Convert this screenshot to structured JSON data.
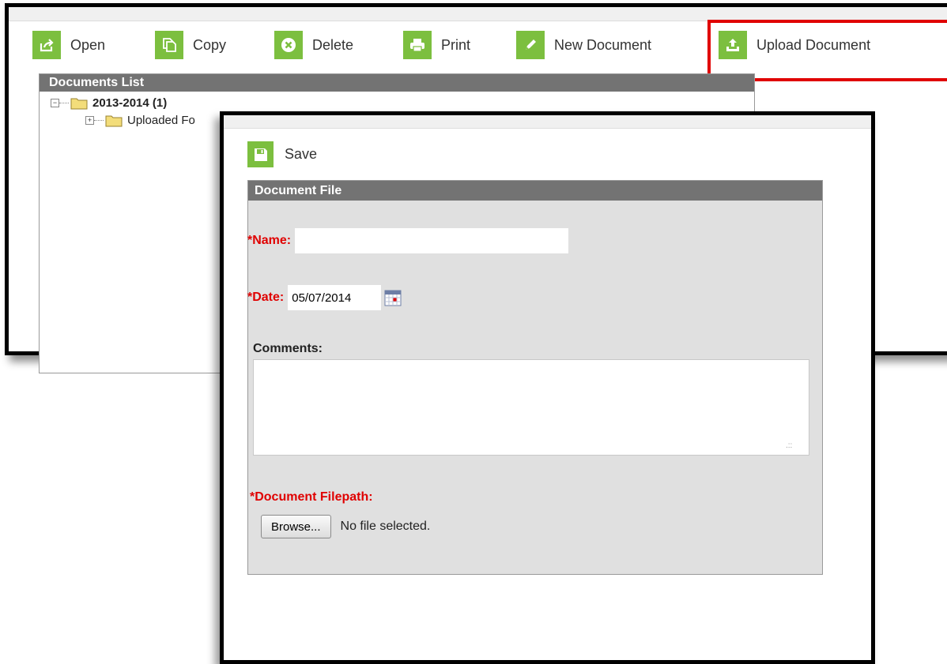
{
  "toolbar": {
    "open_label": "Open",
    "copy_label": "Copy",
    "delete_label": "Delete",
    "print_label": "Print",
    "new_document_label": "New Document",
    "upload_document_label": "Upload Document"
  },
  "documents_list": {
    "title": "Documents List",
    "tree": [
      {
        "label": "2013-2014 (1)"
      },
      {
        "label": "Uploaded Fo"
      }
    ]
  },
  "dialog": {
    "save_label": "Save",
    "panel_title": "Document File",
    "name": {
      "label": "*Name:",
      "value": ""
    },
    "date": {
      "label": "*Date:",
      "value": "05/07/2014"
    },
    "comments": {
      "label": "Comments:",
      "value": ""
    },
    "filepath": {
      "label": "*Document Filepath:",
      "browse_label": "Browse...",
      "status": "No file selected."
    }
  },
  "colors": {
    "accent_green": "#7cbf3f",
    "header_gray": "#737373",
    "required_red": "#e00000",
    "highlight_red": "#e00000"
  },
  "icons": [
    "open-icon",
    "copy-icon",
    "delete-icon",
    "print-icon",
    "new-document-icon",
    "upload-document-icon",
    "save-icon",
    "calendar-icon",
    "folder-icon"
  ]
}
